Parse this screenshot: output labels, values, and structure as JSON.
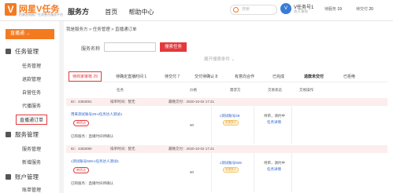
{
  "brand": {
    "name": "网星V任务",
    "tagline": "招募营销推广任务整合服务平台",
    "mark": "V"
  },
  "topnav": {
    "service": "服务方",
    "home": "首页",
    "help": "帮助中心"
  },
  "search": {
    "placeholder": "搜索"
  },
  "user": {
    "avatar_text": "V",
    "name": "V任务号1",
    "role": "达人身份",
    "stat1_label": "待服务",
    "stat1_value": "19",
    "stat2_label": "待交付",
    "stat2_value": "20"
  },
  "sidebar": {
    "title": "直播通 →",
    "groups": [
      {
        "label": "任务管理",
        "items": [
          "任务管理",
          "退款管理",
          "自营任务",
          "代播服务",
          "直播通订单"
        ]
      },
      {
        "label": "服务管理",
        "items": [
          "服务管理",
          "新增服务"
        ]
      },
      {
        "label": "账户管理",
        "items": [
          "账单管理"
        ]
      }
    ]
  },
  "breadcrumb": "我是服务方  >  任务管理  >  直播通订单",
  "form": {
    "service_label": "服务名称",
    "search_button": "搜索任务",
    "filter_label": "展开搜索条件 ⌄"
  },
  "tabs": [
    {
      "label": "待商家审核 29"
    },
    {
      "label": "待确定直播时间 1"
    },
    {
      "label": "待交付 7"
    },
    {
      "label": "交付待确认 8"
    },
    {
      "label": "有意向合作"
    },
    {
      "label": "已完成"
    },
    {
      "label": "退款未交付"
    },
    {
      "label": "已拒绝"
    }
  ],
  "table_headers": [
    "任务",
    "价格",
    "需求方",
    "交易状态",
    "交易操作"
  ],
  "orders": [
    {
      "id": "ID：4383091",
      "schedule": "排单时间：暂无",
      "deadline": "最晚交付：2020-10-02 17:21",
      "title": "用来测试账号29-v任务达人测试1",
      "tag": "带货达",
      "price": "¥0",
      "buyer": "c测试账号49",
      "buyer_badge": "可发货人",
      "status": "待审，请约中",
      "detail": "任务详情",
      "note": "已购服务：直播时间待确认"
    },
    {
      "id": "ID：4383090",
      "schedule": "排单时间：暂无",
      "deadline": "最晚交付：2020-10-02 17:21",
      "title": "c测试账号929-v任务达人测试1",
      "tag": "带货达",
      "price": "¥0",
      "buyer": "c测试账号929",
      "buyer_badge": "可发货人",
      "status": "待审，请约中",
      "detail": "任务详情",
      "note": "已购服务：直播时间待确认"
    }
  ]
}
